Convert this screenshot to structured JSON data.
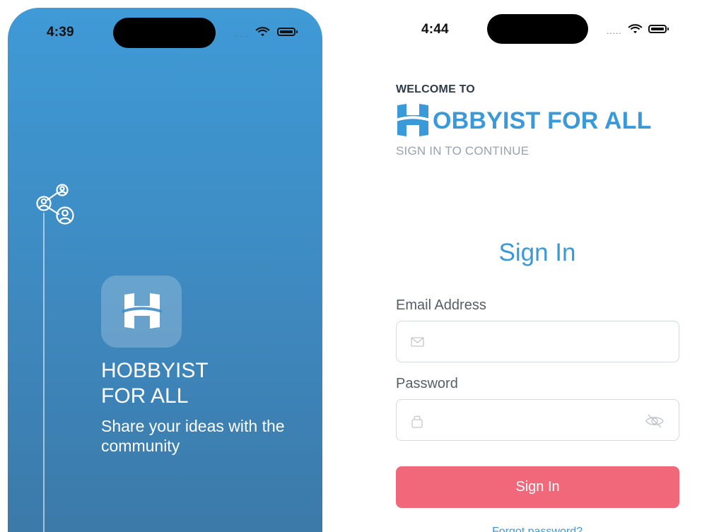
{
  "splash_screen": {
    "status_bar": {
      "time": "4:39",
      "signal_dots": "....."
    },
    "title_line1": "HOBBYIST",
    "title_line2": "FOR ALL",
    "tagline": "Share your ideas with the community",
    "gradient_colors": [
      "#3f9ad6",
      "#3c79a8"
    ]
  },
  "signin_screen": {
    "status_bar": {
      "time": "4:44",
      "signal_dots": "....."
    },
    "welcome_label": "WELCOME TO",
    "brand_name": "OBBYIST FOR ALL",
    "subtitle": "SIGN IN TO CONTINUE",
    "heading": "Sign In",
    "email": {
      "label": "Email Address",
      "value": "",
      "icon": "mail-icon"
    },
    "password": {
      "label": "Password",
      "value": "",
      "icon": "lock-icon",
      "toggle_icon": "eye-slash-icon"
    },
    "submit_label": "Sign In",
    "forgot_label": "Forgot password?"
  },
  "colors": {
    "brand_blue": "#3a99d8",
    "button_pink": "#f1687a",
    "label_gray": "#555d66",
    "muted_gray": "#98a2ad"
  }
}
